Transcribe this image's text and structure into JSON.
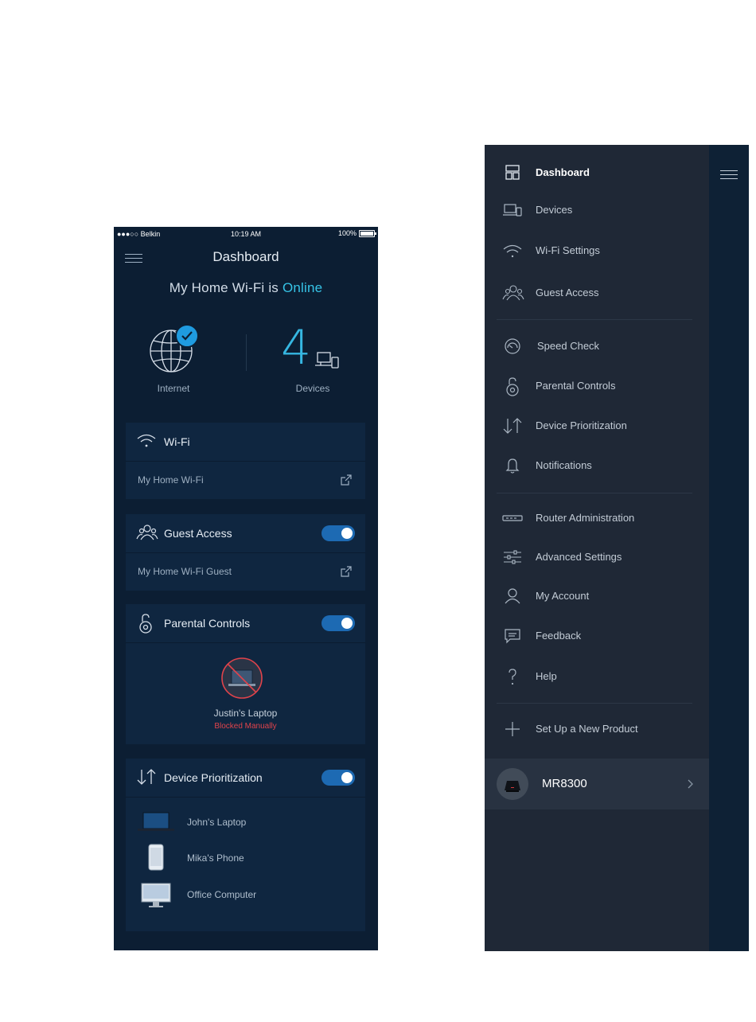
{
  "phone": {
    "status": {
      "carrier": "●●●○○ Belkin",
      "time": "10:19 AM",
      "battery": "100%"
    },
    "title": "Dashboard",
    "online_prefix": "My Home Wi-Fi is ",
    "online_status": "Online",
    "internet_label": "Internet",
    "device_count": "4",
    "devices_label": "Devices",
    "wifi": {
      "title": "Wi-Fi",
      "network": "My Home Wi-Fi"
    },
    "guest": {
      "title": "Guest Access",
      "network": "My Home Wi-Fi Guest",
      "enabled": true
    },
    "parental": {
      "title": "Parental Controls",
      "device": "Justin's Laptop",
      "status": "Blocked Manually",
      "enabled": true
    },
    "prioritization": {
      "title": "Device Prioritization",
      "enabled": true,
      "devices": [
        "John's Laptop",
        "Mika's Phone",
        "Office Computer"
      ]
    }
  },
  "menu": {
    "items": [
      {
        "label": "Dashboard",
        "icon": "dashboard-icon",
        "active": true
      },
      {
        "label": "Devices",
        "icon": "devices-icon"
      },
      {
        "label": "Wi-Fi Settings",
        "icon": "wifi-icon"
      },
      {
        "label": "Guest Access",
        "icon": "guest-icon"
      },
      {
        "label": "Speed Check",
        "icon": "speedometer-icon"
      },
      {
        "label": "Parental Controls",
        "icon": "lock-icon"
      },
      {
        "label": "Device Prioritization",
        "icon": "prioritize-arrows-icon"
      },
      {
        "label": "Notifications",
        "icon": "bell-icon"
      },
      {
        "label": "Router Administration",
        "icon": "router-icon"
      },
      {
        "label": "Advanced Settings",
        "icon": "sliders-icon"
      },
      {
        "label": "My Account",
        "icon": "person-icon"
      },
      {
        "label": "Feedback",
        "icon": "chat-icon"
      },
      {
        "label": "Help",
        "icon": "question-icon"
      },
      {
        "label": "Set Up a New Product",
        "icon": "plus-icon"
      }
    ],
    "product": {
      "name": "MR8300"
    }
  },
  "colors": {
    "accent": "#36c3e6",
    "toggle": "#1d6ab3",
    "blocked": "#e0434b"
  }
}
